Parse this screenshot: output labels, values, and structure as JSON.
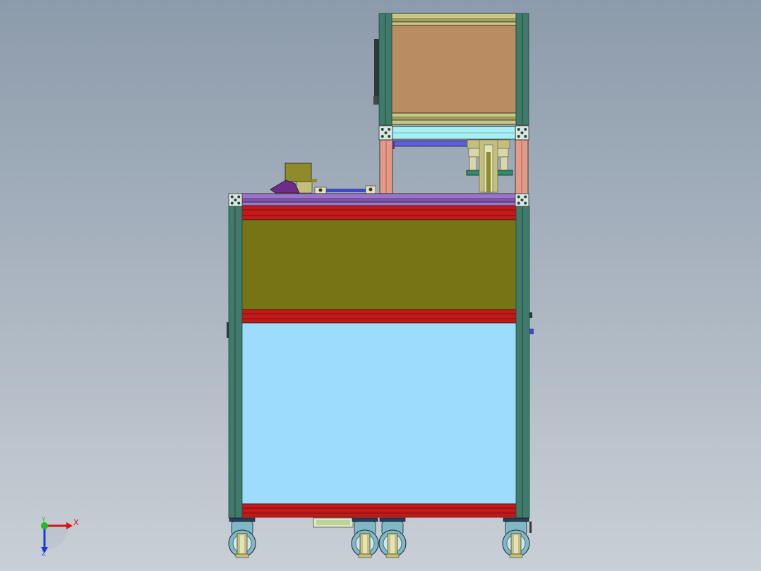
{
  "viewport": {
    "background_top": "#8c9bab",
    "background_bottom": "#c9cfd6"
  },
  "colors": {
    "frame_profile": "#3f7a6b",
    "frame_profile_dark": "#1e4a3e",
    "frame_profile_light": "#6fa596",
    "upper_panel": "#b98d61",
    "upper_rail": "#c8c783",
    "pillar_salmon": "#e39a87",
    "cyan_bar": "#a7eff2",
    "blue_rod": "#5a5ee0",
    "table_top": "#9c74cc",
    "red_beam": "#c31919",
    "olive_panel": "#767415",
    "sky_panel": "#9edcfe",
    "caster_metal": "#7fb9c6",
    "caster_gold": "#c4c07a",
    "motor_olive": "#8f8a2a",
    "motor_purple": "#6d2b8a",
    "green_part": "#2e8b6e"
  },
  "triad": {
    "x_label": "X",
    "y_label": "Y",
    "z_label": "Z",
    "x_color": "#e01010",
    "y_color": "#1cbf1c",
    "z_color": "#1a3ccf"
  }
}
